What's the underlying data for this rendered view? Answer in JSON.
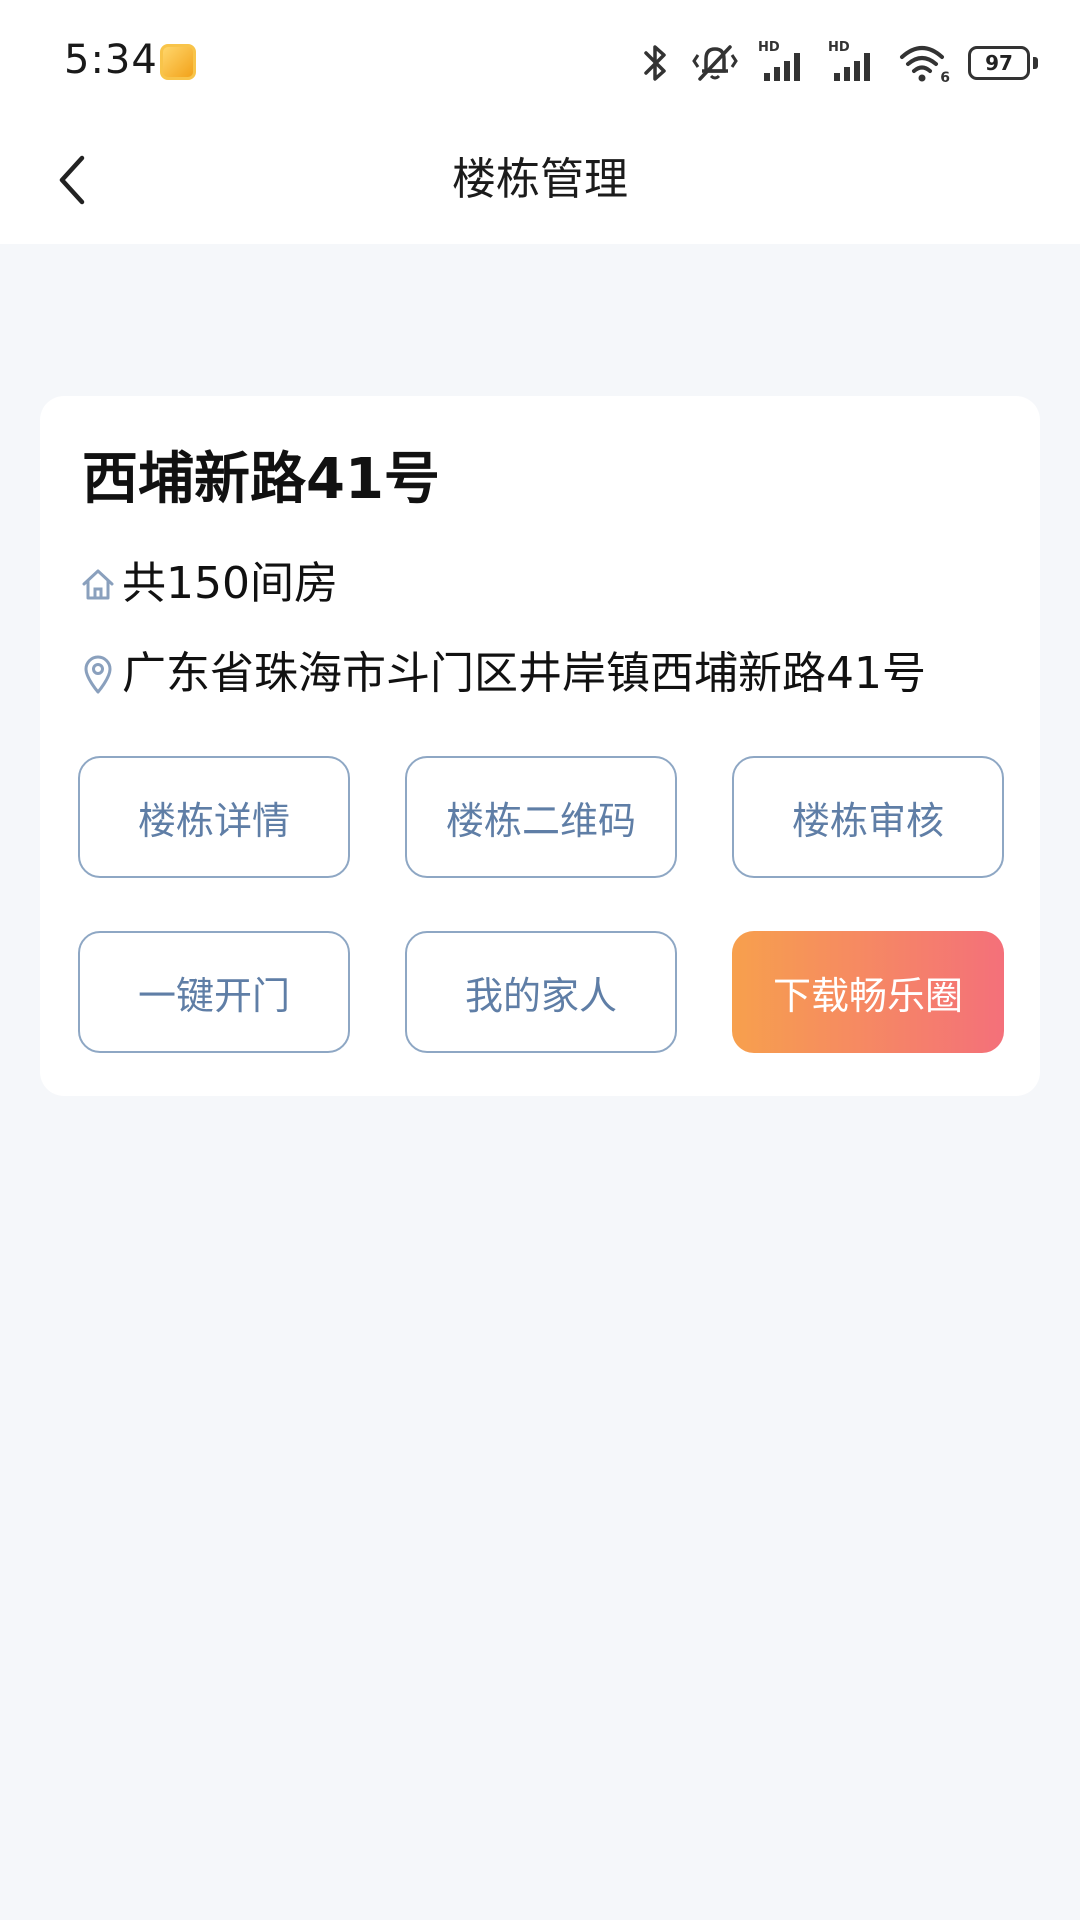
{
  "status_bar": {
    "time": "5:34",
    "battery_level": "97",
    "signal_1_label": "HD",
    "signal_2_label": "HD",
    "wifi_badge": "6",
    "icons": [
      "app-notification-icon",
      "bluetooth-icon",
      "vibrate-mute-icon",
      "signal-icon",
      "signal-icon",
      "wifi-icon",
      "battery-icon"
    ]
  },
  "nav": {
    "title": "楼栋管理"
  },
  "card": {
    "building_name": "西埔新路41号",
    "rooms_text": "共150间房",
    "address_text": "广东省珠海市斗门区井岸镇西埔新路41号",
    "buttons": [
      {
        "label": "楼栋详情"
      },
      {
        "label": "楼栋二维码"
      },
      {
        "label": "楼栋审核"
      },
      {
        "label": "一键开门"
      },
      {
        "label": "我的家人"
      },
      {
        "label": "下载畅乐圈"
      }
    ]
  },
  "colors": {
    "page_bg": "#f5f7fa",
    "outline_button_border": "#8ea7c4",
    "outline_button_text": "#5f7ea6",
    "primary_gradient_start": "#f7a04d",
    "primary_gradient_end": "#f4707a",
    "info_icon": "#8aa0bd"
  }
}
